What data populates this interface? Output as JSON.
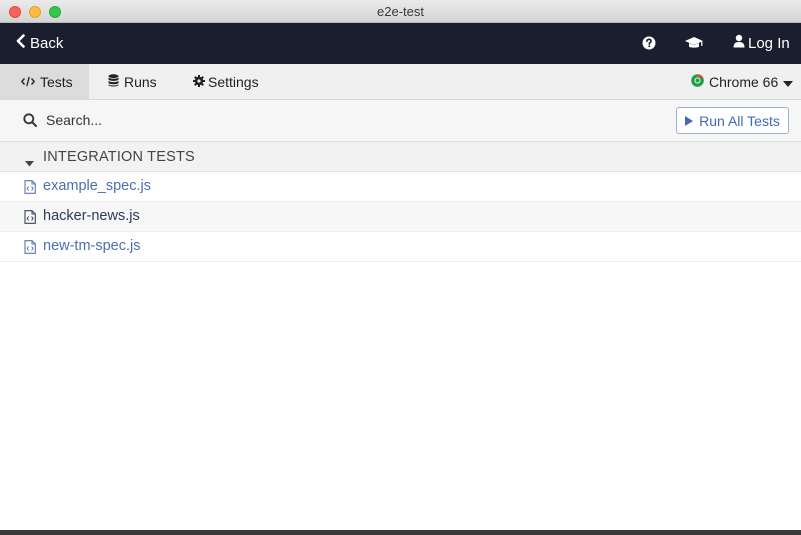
{
  "window": {
    "title": "e2e-test"
  },
  "header": {
    "back_label": "Back",
    "help_icon": "question-circle-icon",
    "docs_icon": "graduation-cap-icon",
    "login_label": "Log In"
  },
  "nav": {
    "tabs": [
      {
        "label": "Tests",
        "icon": "code-icon",
        "active": true
      },
      {
        "label": "Runs",
        "icon": "database-icon",
        "active": false
      },
      {
        "label": "Settings",
        "icon": "gear-icon",
        "active": false
      }
    ],
    "browser": {
      "label": "Chrome 66",
      "icon": "chrome-icon"
    }
  },
  "search": {
    "placeholder": "Search...",
    "value": ""
  },
  "run_all_label": "Run All Tests",
  "folder": {
    "label": "INTEGRATION TESTS",
    "expanded": true
  },
  "specs": [
    {
      "name": "example_spec.js",
      "color": "#4a6fb0"
    },
    {
      "name": "hacker-news.js",
      "color": "#2e3a55"
    },
    {
      "name": "new-tm-spec.js",
      "color": "#4a6fb0"
    }
  ],
  "colors": {
    "header_bg": "#1b1e2e",
    "accent": "#3f6bb5",
    "chrome_green": "#1e9e4b"
  }
}
